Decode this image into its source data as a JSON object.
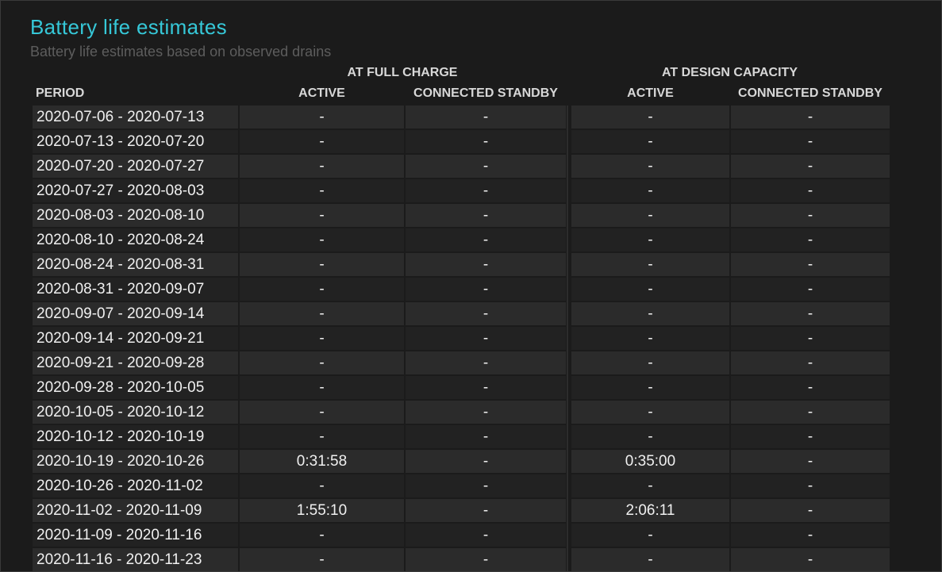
{
  "header": {
    "title": "Battery life estimates",
    "subtitle": "Battery life estimates based on observed drains"
  },
  "columns": {
    "group_full_charge": "AT FULL CHARGE",
    "group_design_capacity": "AT DESIGN CAPACITY",
    "period": "PERIOD",
    "full_active": "ACTIVE",
    "full_standby": "CONNECTED STANDBY",
    "design_active": "ACTIVE",
    "design_standby": "CONNECTED STANDBY"
  },
  "rows": [
    {
      "period": "2020-07-06 - 2020-07-13",
      "full_active": "-",
      "full_standby": "-",
      "design_active": "-",
      "design_standby": "-"
    },
    {
      "period": "2020-07-13 - 2020-07-20",
      "full_active": "-",
      "full_standby": "-",
      "design_active": "-",
      "design_standby": "-"
    },
    {
      "period": "2020-07-20 - 2020-07-27",
      "full_active": "-",
      "full_standby": "-",
      "design_active": "-",
      "design_standby": "-"
    },
    {
      "period": "2020-07-27 - 2020-08-03",
      "full_active": "-",
      "full_standby": "-",
      "design_active": "-",
      "design_standby": "-"
    },
    {
      "period": "2020-08-03 - 2020-08-10",
      "full_active": "-",
      "full_standby": "-",
      "design_active": "-",
      "design_standby": "-"
    },
    {
      "period": "2020-08-10 - 2020-08-24",
      "full_active": "-",
      "full_standby": "-",
      "design_active": "-",
      "design_standby": "-"
    },
    {
      "period": "2020-08-24 - 2020-08-31",
      "full_active": "-",
      "full_standby": "-",
      "design_active": "-",
      "design_standby": "-"
    },
    {
      "period": "2020-08-31 - 2020-09-07",
      "full_active": "-",
      "full_standby": "-",
      "design_active": "-",
      "design_standby": "-"
    },
    {
      "period": "2020-09-07 - 2020-09-14",
      "full_active": "-",
      "full_standby": "-",
      "design_active": "-",
      "design_standby": "-"
    },
    {
      "period": "2020-09-14 - 2020-09-21",
      "full_active": "-",
      "full_standby": "-",
      "design_active": "-",
      "design_standby": "-"
    },
    {
      "period": "2020-09-21 - 2020-09-28",
      "full_active": "-",
      "full_standby": "-",
      "design_active": "-",
      "design_standby": "-"
    },
    {
      "period": "2020-09-28 - 2020-10-05",
      "full_active": "-",
      "full_standby": "-",
      "design_active": "-",
      "design_standby": "-"
    },
    {
      "period": "2020-10-05 - 2020-10-12",
      "full_active": "-",
      "full_standby": "-",
      "design_active": "-",
      "design_standby": "-"
    },
    {
      "period": "2020-10-12 - 2020-10-19",
      "full_active": "-",
      "full_standby": "-",
      "design_active": "-",
      "design_standby": "-"
    },
    {
      "period": "2020-10-19 - 2020-10-26",
      "full_active": "0:31:58",
      "full_standby": "-",
      "design_active": "0:35:00",
      "design_standby": "-"
    },
    {
      "period": "2020-10-26 - 2020-11-02",
      "full_active": "-",
      "full_standby": "-",
      "design_active": "-",
      "design_standby": "-"
    },
    {
      "period": "2020-11-02 - 2020-11-09",
      "full_active": "1:55:10",
      "full_standby": "-",
      "design_active": "2:06:11",
      "design_standby": "-"
    },
    {
      "period": "2020-11-09 - 2020-11-16",
      "full_active": "-",
      "full_standby": "-",
      "design_active": "-",
      "design_standby": "-"
    },
    {
      "period": "2020-11-16 - 2020-11-23",
      "full_active": "-",
      "full_standby": "-",
      "design_active": "-",
      "design_standby": "-"
    }
  ]
}
